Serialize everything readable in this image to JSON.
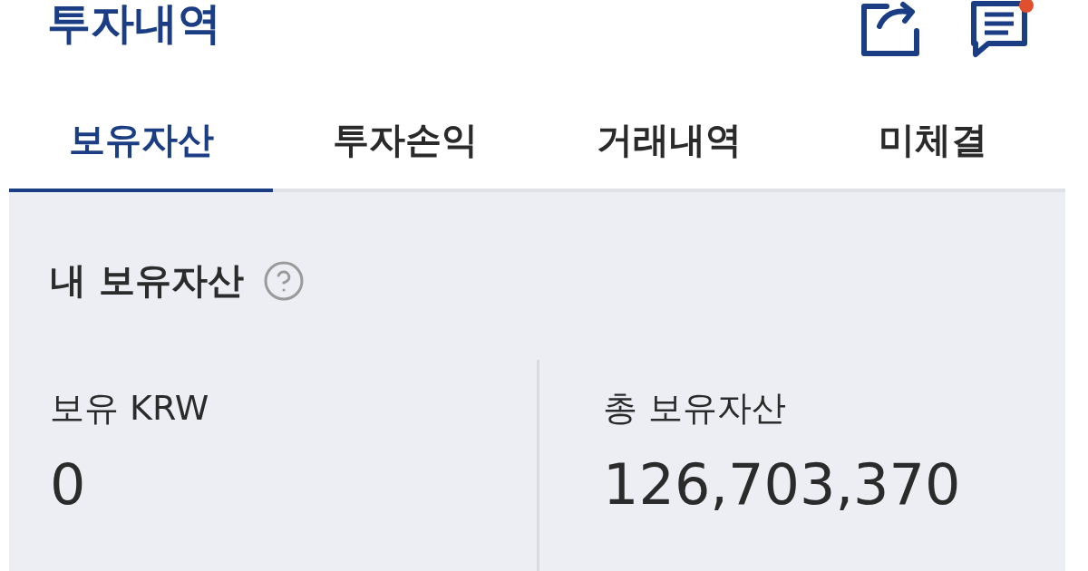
{
  "header": {
    "title": "투자내역",
    "notification_badge": true
  },
  "tabs": [
    {
      "label": "보유자산",
      "selected": true
    },
    {
      "label": "투자손익",
      "selected": false
    },
    {
      "label": "거래내역",
      "selected": false
    },
    {
      "label": "미체결",
      "selected": false
    }
  ],
  "summary": {
    "title": "내 보유자산",
    "items": [
      {
        "label": "보유 KRW",
        "value": "0"
      },
      {
        "label": "총 보유자산",
        "value": "126,703,370"
      }
    ]
  }
}
